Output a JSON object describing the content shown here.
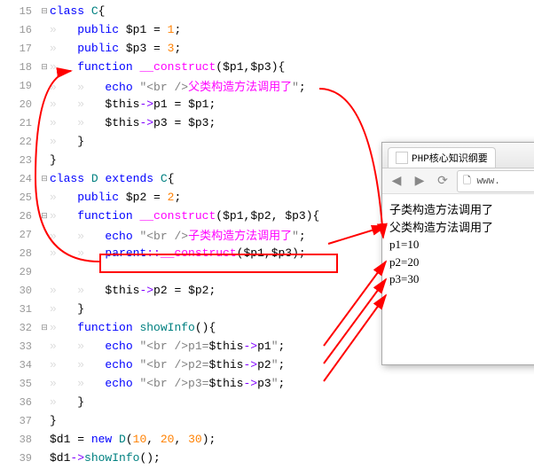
{
  "lines": {
    "15": {
      "n": "15",
      "fold": "⊟",
      "tokens": [
        [
          "kw",
          "class"
        ],
        [
          "pl",
          " "
        ],
        [
          "nm",
          "C"
        ],
        [
          "pl",
          "{"
        ]
      ]
    },
    "16": {
      "n": "16",
      "tokens": [
        [
          "ws",
          "»   "
        ],
        [
          "kw",
          "public"
        ],
        [
          "pl",
          " "
        ],
        [
          "var",
          "$p1"
        ],
        [
          "pl",
          " = "
        ],
        [
          "num",
          "1"
        ],
        [
          "pl",
          ";"
        ]
      ]
    },
    "17": {
      "n": "17",
      "tokens": [
        [
          "ws",
          "»   "
        ],
        [
          "kw",
          "public"
        ],
        [
          "pl",
          " "
        ],
        [
          "var",
          "$p3"
        ],
        [
          "pl",
          " = "
        ],
        [
          "num",
          "3"
        ],
        [
          "pl",
          ";"
        ]
      ]
    },
    "18": {
      "n": "18",
      "fold": "⊟",
      "tokens": [
        [
          "ws",
          "»   "
        ],
        [
          "kw",
          "function"
        ],
        [
          "pl",
          " "
        ],
        [
          "fn",
          "__construct"
        ],
        [
          "pl",
          "("
        ],
        [
          "var",
          "$p1"
        ],
        [
          "pl",
          ","
        ],
        [
          "var",
          "$p3"
        ],
        [
          "pl",
          "){"
        ]
      ]
    },
    "19": {
      "n": "19",
      "tokens": [
        [
          "ws",
          "»   »   "
        ],
        [
          "kw",
          "echo"
        ],
        [
          "pl",
          " "
        ],
        [
          "str",
          "\"<br />"
        ],
        [
          "strcn",
          "父类构造方法调用了"
        ],
        [
          "str",
          "\""
        ],
        [
          "pl",
          ";"
        ]
      ]
    },
    "20": {
      "n": "20",
      "tokens": [
        [
          "ws",
          "»   »   "
        ],
        [
          "var",
          "$this"
        ],
        [
          "op",
          "->"
        ],
        [
          "var",
          "p1"
        ],
        [
          "pl",
          " = "
        ],
        [
          "var",
          "$p1"
        ],
        [
          "pl",
          ";"
        ]
      ]
    },
    "21": {
      "n": "21",
      "tokens": [
        [
          "ws",
          "»   »   "
        ],
        [
          "var",
          "$this"
        ],
        [
          "op",
          "->"
        ],
        [
          "var",
          "p3"
        ],
        [
          "pl",
          " = "
        ],
        [
          "var",
          "$p3"
        ],
        [
          "pl",
          ";"
        ]
      ]
    },
    "22": {
      "n": "22",
      "tokens": [
        [
          "ws",
          "»   "
        ],
        [
          "pl",
          "}"
        ]
      ]
    },
    "23": {
      "n": "23",
      "tokens": [
        [
          "pl",
          "}"
        ]
      ]
    },
    "24": {
      "n": "24",
      "fold": "⊟",
      "tokens": [
        [
          "kw",
          "class"
        ],
        [
          "pl",
          " "
        ],
        [
          "nm",
          "D"
        ],
        [
          "pl",
          " "
        ],
        [
          "kw",
          "extends"
        ],
        [
          "pl",
          " "
        ],
        [
          "nm",
          "C"
        ],
        [
          "pl",
          "{"
        ]
      ]
    },
    "25": {
      "n": "25",
      "tokens": [
        [
          "ws",
          "»   "
        ],
        [
          "kw",
          "public"
        ],
        [
          "pl",
          " "
        ],
        [
          "var",
          "$p2"
        ],
        [
          "pl",
          " = "
        ],
        [
          "num",
          "2"
        ],
        [
          "pl",
          ";"
        ]
      ]
    },
    "26": {
      "n": "26",
      "fold": "⊟",
      "tokens": [
        [
          "ws",
          "»   "
        ],
        [
          "kw",
          "function"
        ],
        [
          "pl",
          " "
        ],
        [
          "fn",
          "__construct"
        ],
        [
          "pl",
          "("
        ],
        [
          "var",
          "$p1"
        ],
        [
          "pl",
          ","
        ],
        [
          "var",
          "$p2"
        ],
        [
          "pl",
          ", "
        ],
        [
          "var",
          "$p3"
        ],
        [
          "pl",
          "){"
        ]
      ]
    },
    "27": {
      "n": "27",
      "tokens": [
        [
          "ws",
          "»   »   "
        ],
        [
          "kw",
          "echo"
        ],
        [
          "pl",
          " "
        ],
        [
          "str",
          "\"<br />"
        ],
        [
          "strcn",
          "子类构造方法调用了"
        ],
        [
          "str",
          "\""
        ],
        [
          "pl",
          ";"
        ]
      ]
    },
    "28": {
      "n": "28",
      "tokens": [
        [
          "ws",
          "»   »   "
        ],
        [
          "kw",
          "parent"
        ],
        [
          "op",
          "::"
        ],
        [
          "fn",
          "__construct"
        ],
        [
          "pl",
          "("
        ],
        [
          "var",
          "$p1"
        ],
        [
          "pl",
          ","
        ],
        [
          "var",
          "$p3"
        ],
        [
          "pl",
          ");"
        ]
      ]
    },
    "29": {
      "n": "29",
      "tokens": []
    },
    "30": {
      "n": "30",
      "tokens": [
        [
          "ws",
          "»   »   "
        ],
        [
          "var",
          "$this"
        ],
        [
          "op",
          "->"
        ],
        [
          "var",
          "p2"
        ],
        [
          "pl",
          " = "
        ],
        [
          "var",
          "$p2"
        ],
        [
          "pl",
          ";"
        ]
      ]
    },
    "31": {
      "n": "31",
      "tokens": [
        [
          "ws",
          "»   "
        ],
        [
          "pl",
          "}"
        ]
      ]
    },
    "32": {
      "n": "32",
      "fold": "⊟",
      "tokens": [
        [
          "ws",
          "»   "
        ],
        [
          "kw",
          "function"
        ],
        [
          "pl",
          " "
        ],
        [
          "nm",
          "showInfo"
        ],
        [
          "pl",
          "(){"
        ]
      ]
    },
    "33": {
      "n": "33",
      "tokens": [
        [
          "ws",
          "»   »   "
        ],
        [
          "kw",
          "echo"
        ],
        [
          "pl",
          " "
        ],
        [
          "str",
          "\"<br />p1="
        ],
        [
          "var",
          "$this"
        ],
        [
          "op",
          "->"
        ],
        [
          "var",
          "p1"
        ],
        [
          "str",
          "\""
        ],
        [
          "pl",
          ";"
        ]
      ]
    },
    "34": {
      "n": "34",
      "tokens": [
        [
          "ws",
          "»   »   "
        ],
        [
          "kw",
          "echo"
        ],
        [
          "pl",
          " "
        ],
        [
          "str",
          "\"<br />p2="
        ],
        [
          "var",
          "$this"
        ],
        [
          "op",
          "->"
        ],
        [
          "var",
          "p2"
        ],
        [
          "str",
          "\""
        ],
        [
          "pl",
          ";"
        ]
      ]
    },
    "35": {
      "n": "35",
      "tokens": [
        [
          "ws",
          "»   »   "
        ],
        [
          "kw",
          "echo"
        ],
        [
          "pl",
          " "
        ],
        [
          "str",
          "\"<br />p3="
        ],
        [
          "var",
          "$this"
        ],
        [
          "op",
          "->"
        ],
        [
          "var",
          "p3"
        ],
        [
          "str",
          "\""
        ],
        [
          "pl",
          ";"
        ]
      ]
    },
    "36": {
      "n": "36",
      "tokens": [
        [
          "ws",
          "»   "
        ],
        [
          "pl",
          "}"
        ]
      ]
    },
    "37": {
      "n": "37",
      "tokens": [
        [
          "pl",
          "}"
        ]
      ]
    },
    "38": {
      "n": "38",
      "tokens": [
        [
          "var",
          "$d1"
        ],
        [
          "pl",
          " = "
        ],
        [
          "kw",
          "new"
        ],
        [
          "pl",
          " "
        ],
        [
          "nm",
          "D"
        ],
        [
          "pl",
          "("
        ],
        [
          "num",
          "10"
        ],
        [
          "pl",
          ", "
        ],
        [
          "num",
          "20"
        ],
        [
          "pl",
          ", "
        ],
        [
          "num",
          "30"
        ],
        [
          "pl",
          ");"
        ]
      ]
    },
    "39": {
      "n": "39",
      "tokens": [
        [
          "var",
          "$d1"
        ],
        [
          "op",
          "->"
        ],
        [
          "nm",
          "showInfo"
        ],
        [
          "pl",
          "();"
        ]
      ]
    }
  },
  "lineOrder": [
    "15",
    "16",
    "17",
    "18",
    "19",
    "20",
    "21",
    "22",
    "23",
    "24",
    "25",
    "26",
    "27",
    "28",
    "29",
    "30",
    "31",
    "32",
    "33",
    "34",
    "35",
    "36",
    "37",
    "38",
    "39"
  ],
  "browser": {
    "tabTitle": "PHP核心知识纲要",
    "url": "www.",
    "output": [
      "子类构造方法调用了",
      "父类构造方法调用了",
      "p1=10",
      "p2=20",
      "p3=30"
    ]
  }
}
